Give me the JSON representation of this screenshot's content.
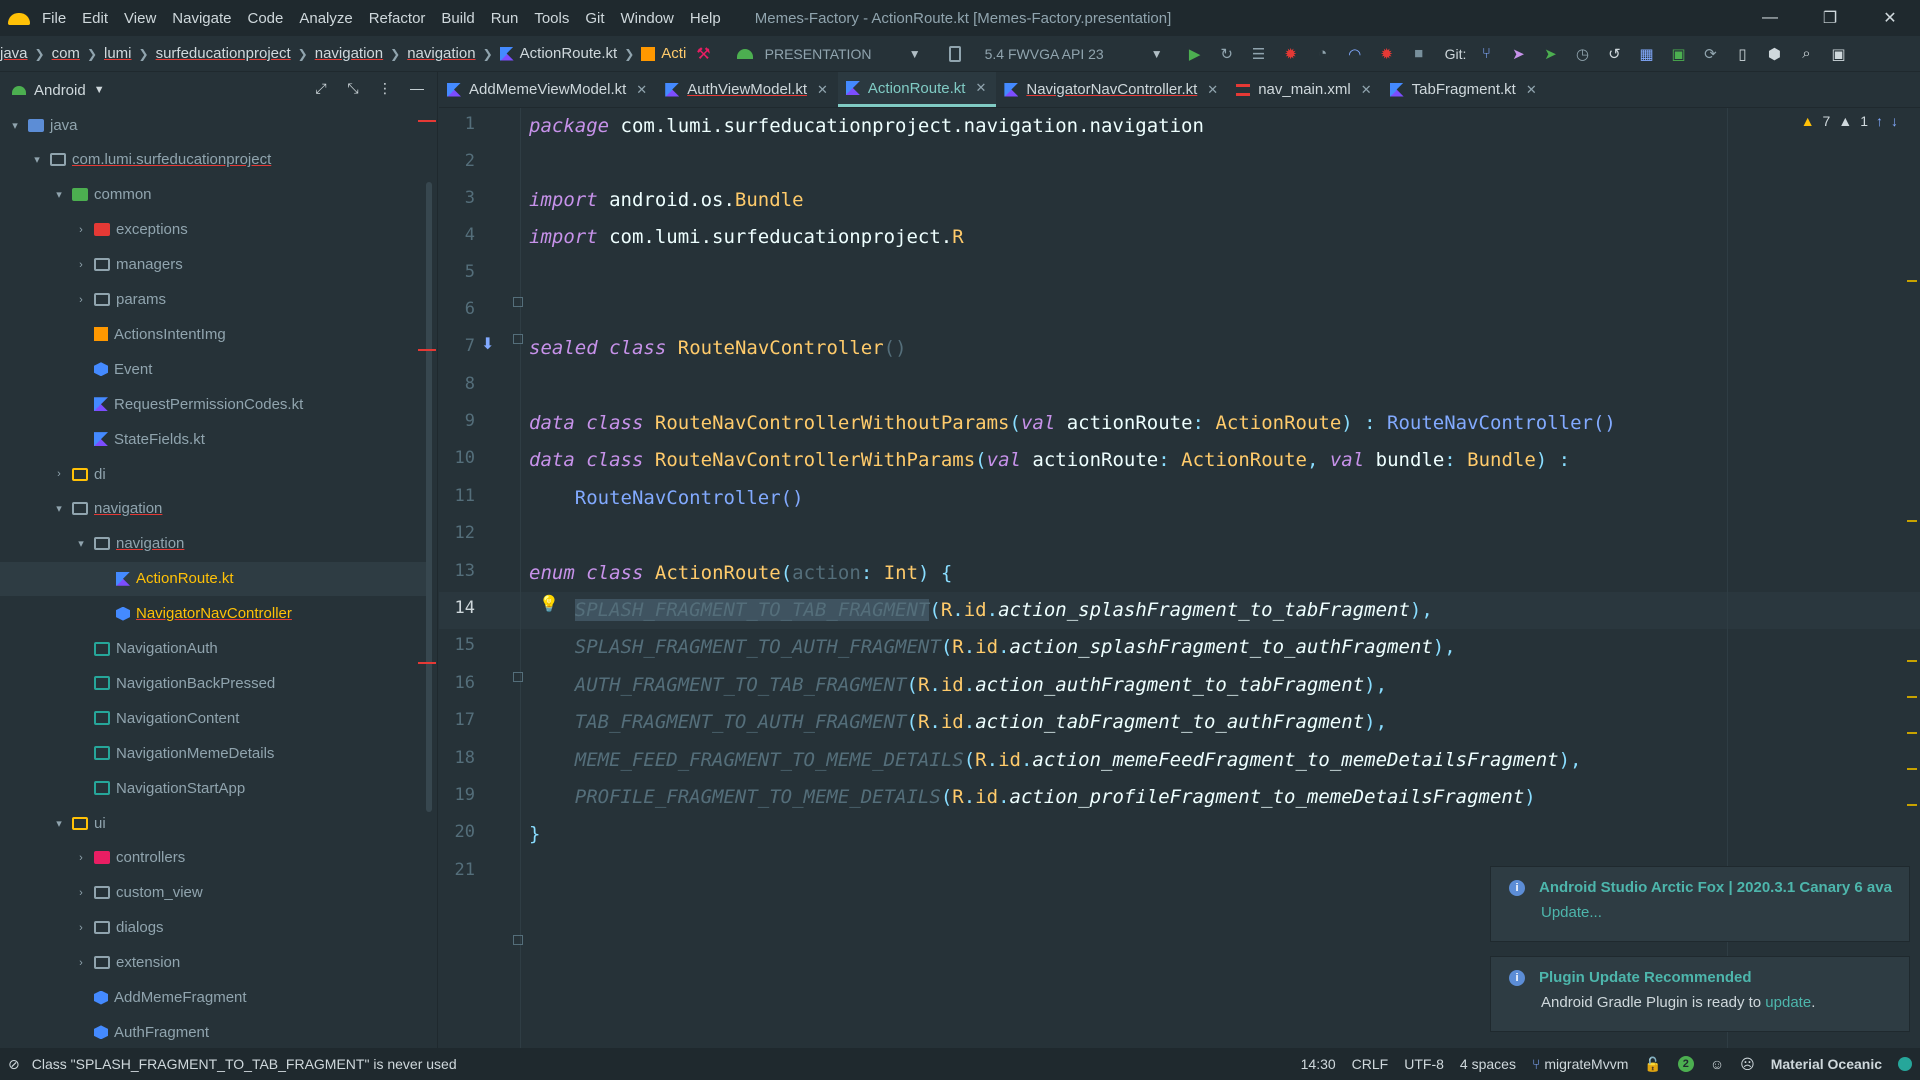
{
  "menu": {
    "items": [
      "File",
      "Edit",
      "View",
      "Navigate",
      "Code",
      "Analyze",
      "Refactor",
      "Build",
      "Run",
      "Tools",
      "Git",
      "Window",
      "Help"
    ],
    "title": "Memes-Factory - ActionRoute.kt [Memes-Factory.presentation]",
    "minimize": "—",
    "restore": "❐",
    "close": "✕"
  },
  "breadcrumbs": [
    "java",
    "com",
    "lumi",
    "surfeducationproject",
    "navigation",
    "navigation",
    "ActionRoute.kt",
    "Acti"
  ],
  "toolbar": {
    "run_config": "PRESENTATION",
    "device": "5.4  FWVGA API 23",
    "git_label": "Git:"
  },
  "project": {
    "view_label": "Android",
    "tree": [
      {
        "label": "java",
        "depth": 1,
        "chev": "▾",
        "icon": "ic-folder-blue"
      },
      {
        "label": "com.lumi.surfeducationproject",
        "depth": 2,
        "chev": "▾",
        "icon": "ic-folder",
        "underline": true
      },
      {
        "label": "common",
        "depth": 3,
        "chev": "▾",
        "icon": "ic-folder-green"
      },
      {
        "label": "exceptions",
        "depth": 4,
        "chev": "›",
        "icon": "ic-folder-red"
      },
      {
        "label": "managers",
        "depth": 4,
        "chev": "›",
        "icon": "ic-folder"
      },
      {
        "label": "params",
        "depth": 4,
        "chev": "›",
        "icon": "ic-folder"
      },
      {
        "label": "ActionsIntentImg",
        "depth": 4,
        "chev": "",
        "icon": "ic-grid"
      },
      {
        "label": "Event",
        "depth": 4,
        "chev": "",
        "icon": "ic-class"
      },
      {
        "label": "RequestPermissionCodes.kt",
        "depth": 4,
        "chev": "",
        "icon": "ic-kotlin"
      },
      {
        "label": "StateFields.kt",
        "depth": 4,
        "chev": "",
        "icon": "ic-kotlin"
      },
      {
        "label": "di",
        "depth": 3,
        "chev": "›",
        "icon": "ic-folder-yellow"
      },
      {
        "label": "navigation",
        "depth": 3,
        "chev": "▾",
        "icon": "ic-folder",
        "underline": true
      },
      {
        "label": "navigation",
        "depth": 4,
        "chev": "▾",
        "icon": "ic-folder",
        "underline": true
      },
      {
        "label": "ActionRoute.kt",
        "depth": 5,
        "chev": "",
        "icon": "ic-kotlin",
        "yellow": true,
        "selected": true
      },
      {
        "label": "NavigatorNavController",
        "depth": 5,
        "chev": "",
        "icon": "ic-class",
        "yellow": true,
        "underline": true
      },
      {
        "label": "NavigationAuth",
        "depth": 4,
        "chev": "",
        "icon": "ic-navgraph"
      },
      {
        "label": "NavigationBackPressed",
        "depth": 4,
        "chev": "",
        "icon": "ic-navgraph"
      },
      {
        "label": "NavigationContent",
        "depth": 4,
        "chev": "",
        "icon": "ic-navgraph"
      },
      {
        "label": "NavigationMemeDetails",
        "depth": 4,
        "chev": "",
        "icon": "ic-navgraph"
      },
      {
        "label": "NavigationStartApp",
        "depth": 4,
        "chev": "",
        "icon": "ic-navgraph"
      },
      {
        "label": "ui",
        "depth": 3,
        "chev": "▾",
        "icon": "ic-folder-yellow"
      },
      {
        "label": "controllers",
        "depth": 4,
        "chev": "›",
        "icon": "ic-folder-pink"
      },
      {
        "label": "custom_view",
        "depth": 4,
        "chev": "›",
        "icon": "ic-folder"
      },
      {
        "label": "dialogs",
        "depth": 4,
        "chev": "›",
        "icon": "ic-folder"
      },
      {
        "label": "extension",
        "depth": 4,
        "chev": "›",
        "icon": "ic-folder"
      },
      {
        "label": "AddMemeFragment",
        "depth": 4,
        "chev": "",
        "icon": "ic-class"
      },
      {
        "label": "AuthFragment",
        "depth": 4,
        "chev": "",
        "icon": "ic-class"
      }
    ]
  },
  "tabs": [
    {
      "label": "AddMemeViewModel.kt",
      "type": "kotlin"
    },
    {
      "label": "AuthViewModel.kt",
      "type": "kotlin",
      "underline": true
    },
    {
      "label": "ActionRoute.kt",
      "type": "kotlin",
      "active": true
    },
    {
      "label": "NavigatorNavController.kt",
      "type": "kotlin",
      "underline": true
    },
    {
      "label": "nav_main.xml",
      "type": "xml"
    },
    {
      "label": "TabFragment.kt",
      "type": "kotlin"
    }
  ],
  "editor": {
    "line_numbers": [
      "1",
      "2",
      "3",
      "4",
      "5",
      "6",
      "7",
      "8",
      "9",
      "10",
      "11",
      "12",
      "13",
      "14",
      "15",
      "16",
      "17",
      "18",
      "19",
      "20",
      "21"
    ],
    "current_line": "14",
    "warnings": "7",
    "weak_warnings": "1",
    "code": {
      "l1": [
        "package",
        " com.lumi.surfeducationproject.navigation.navigation"
      ],
      "l3": [
        "import",
        " android.os.",
        "Bundle"
      ],
      "l4": [
        "import",
        " com.lumi.surfeducationproject.",
        "R"
      ],
      "l7": [
        "sealed",
        " ",
        "class",
        " ",
        "RouteNavController",
        "()"
      ],
      "l9": [
        "data",
        " ",
        "class",
        " ",
        "RouteNavControllerWithoutParams",
        "(",
        "val",
        " actionRoute",
        ": ",
        "ActionRoute",
        ") : ",
        "RouteNavController",
        "()"
      ],
      "l10": [
        "data",
        " ",
        "class",
        " ",
        "RouteNavControllerWithParams",
        "(",
        "val",
        " actionRoute",
        ": ",
        "ActionRoute",
        ", ",
        "val",
        " bundle",
        ": ",
        "Bundle",
        ") :"
      ],
      "l11": [
        "    ",
        "RouteNavController",
        "()"
      ],
      "l13": [
        "enum",
        " ",
        "class",
        " ",
        "ActionRoute",
        "(",
        "action",
        ": ",
        "Int",
        ") {"
      ],
      "l14": [
        "    ",
        "SPLASH_FRAGMENT_TO_TAB_FRAGMENT",
        "(",
        "R",
        ".",
        "id",
        ".",
        "action_splashFragment_to_tabFragment",
        "),"
      ],
      "l15": [
        "    ",
        "SPLASH_FRAGMENT_TO_AUTH_FRAGMENT",
        "(",
        "R",
        ".",
        "id",
        ".",
        "action_splashFragment_to_authFragment",
        "),"
      ],
      "l16": [
        "    ",
        "AUTH_FRAGMENT_TO_TAB_FRAGMENT",
        "(",
        "R",
        ".",
        "id",
        ".",
        "action_authFragment_to_tabFragment",
        "),"
      ],
      "l17": [
        "    ",
        "TAB_FRAGMENT_TO_AUTH_FRAGMENT",
        "(",
        "R",
        ".",
        "id",
        ".",
        "action_tabFragment_to_authFragment",
        "),"
      ],
      "l18": [
        "    ",
        "MEME_FEED_FRAGMENT_TO_MEME_DETAILS",
        "(",
        "R",
        ".",
        "id",
        ".",
        "action_memeFeedFragment_to_memeDetailsFragment",
        "),"
      ],
      "l19": [
        "    ",
        "PROFILE_FRAGMENT_TO_MEME_DETAILS",
        "(",
        "R",
        ".",
        "id",
        ".",
        "action_profileFragment_to_memeDetailsFragment",
        ")"
      ],
      "l20": [
        "}"
      ]
    }
  },
  "notifications": [
    {
      "title": "Android Studio Arctic Fox | 2020.3.1 Canary 6 ava",
      "body_text": "",
      "link": "Update..."
    },
    {
      "title": "Plugin Update Recommended",
      "body_text": "Android Gradle Plugin is ready to ",
      "link": "update",
      "suffix": "."
    }
  ],
  "status": {
    "message": "Class \"SPLASH_FRAGMENT_TO_TAB_FRAGMENT\" is never used",
    "position": "14:30",
    "line_sep": "CRLF",
    "encoding": "UTF-8",
    "indent": "4 spaces",
    "branch": "migrateMvvm",
    "event_count": "2",
    "theme": "Material Oceanic"
  },
  "colors": {
    "background": "#263238",
    "accent": "#80cbc4",
    "keyword": "#c792ea",
    "class": "#ffcb6b",
    "function": "#82aaff"
  }
}
